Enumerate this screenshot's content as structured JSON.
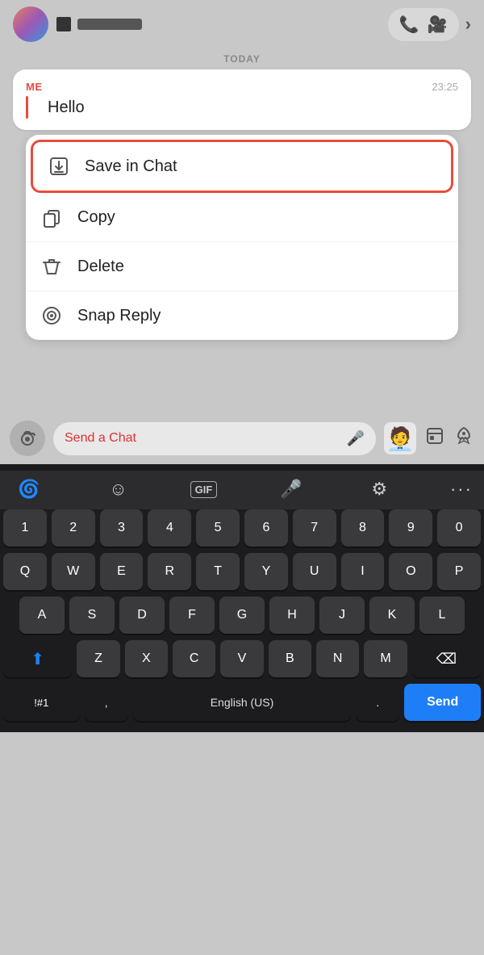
{
  "topBar": {
    "rightChevron": "›",
    "callIcon": "📞",
    "videoIcon": "📹"
  },
  "todayLabel": "TODAY",
  "message": {
    "sender": "ME",
    "time": "23:25",
    "text": "Hello"
  },
  "contextMenu": {
    "items": [
      {
        "id": "save-in-chat",
        "label": "Save in Chat",
        "highlighted": true
      },
      {
        "id": "copy",
        "label": "Copy",
        "highlighted": false
      },
      {
        "id": "delete",
        "label": "Delete",
        "highlighted": false
      },
      {
        "id": "snap-reply",
        "label": "Snap Reply",
        "highlighted": false
      }
    ]
  },
  "chatInput": {
    "placeholder": "Send a Chat"
  },
  "keyboard": {
    "numbers": [
      "1",
      "2",
      "3",
      "4",
      "5",
      "6",
      "7",
      "8",
      "9",
      "0"
    ],
    "row1": [
      "Q",
      "W",
      "E",
      "R",
      "T",
      "Y",
      "U",
      "I",
      "O",
      "P"
    ],
    "row2": [
      "A",
      "S",
      "D",
      "F",
      "G",
      "H",
      "J",
      "K",
      "L"
    ],
    "row3": [
      "Z",
      "X",
      "C",
      "V",
      "B",
      "N",
      "M"
    ],
    "specialLeft": "!#1",
    "comma": ",",
    "space": "English (US)",
    "period": ".",
    "send": "Send"
  }
}
